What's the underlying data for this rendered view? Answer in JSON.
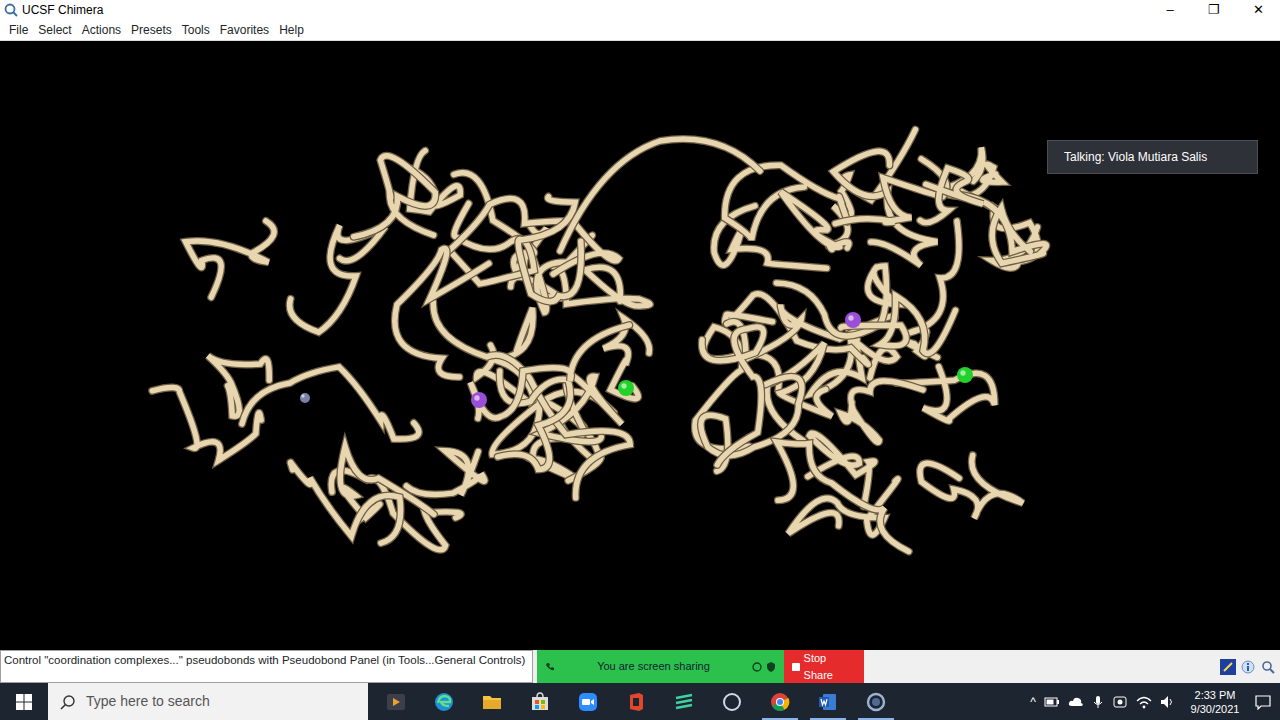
{
  "window": {
    "title": "UCSF Chimera",
    "controls": [
      "–",
      "❐",
      "✕"
    ]
  },
  "menu": [
    "File",
    "Select",
    "Actions",
    "Presets",
    "Tools",
    "Favorites",
    "Help"
  ],
  "overlay": {
    "talking": "Talking: Viola Mutiara Salis"
  },
  "status_bar": {
    "message": "Control \"coordination complexes...\" pseudobonds with Pseudobond Panel (in Tools...General Controls)",
    "sharing": "You are screen sharing",
    "stop": "Stop Share"
  },
  "taskbar": {
    "search": {
      "placeholder": "Type here to search"
    },
    "apps": [
      {
        "kind": "media",
        "running": false
      },
      {
        "kind": "edge",
        "running": false
      },
      {
        "kind": "files",
        "running": false
      },
      {
        "kind": "store",
        "running": false
      },
      {
        "kind": "zoom",
        "running": false
      },
      {
        "kind": "office",
        "running": false
      },
      {
        "kind": "stripes",
        "running": false
      },
      {
        "kind": "ring",
        "running": false
      },
      {
        "kind": "chrome",
        "running": true
      },
      {
        "kind": "word",
        "running": true
      },
      {
        "kind": "chimera",
        "running": true
      }
    ],
    "tray_arrow": "^",
    "time": "2:33 PM",
    "date": "9/30/2021"
  }
}
